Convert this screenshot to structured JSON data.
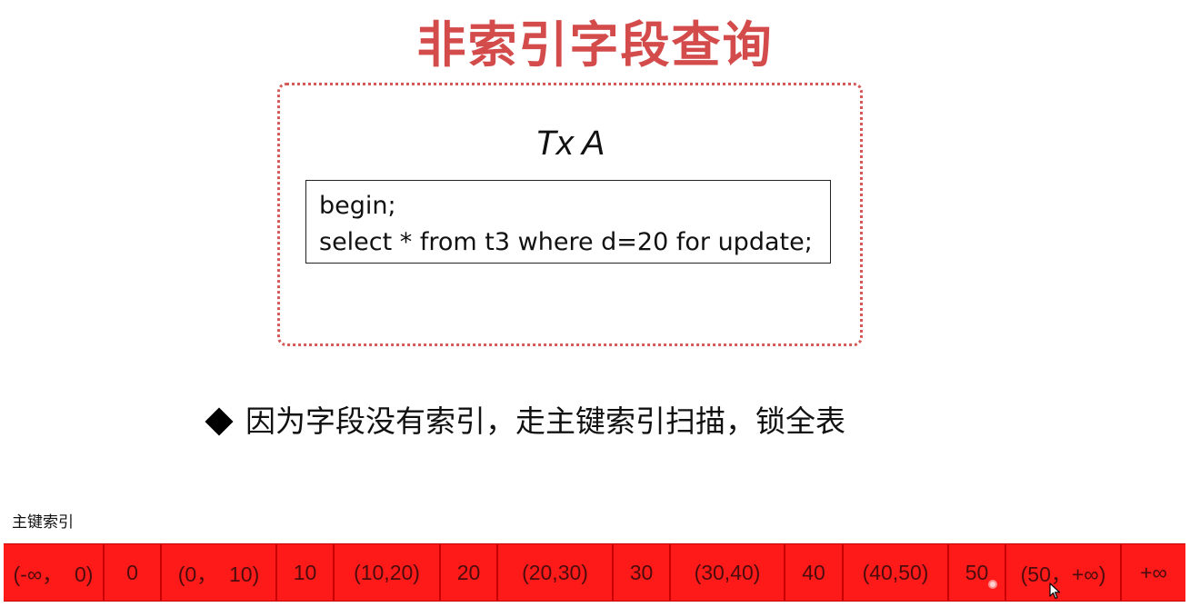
{
  "title": "非索引字段查询",
  "transaction": {
    "name": "Tx A",
    "sql": "begin;\nselect * from t3 where d=20 for update;"
  },
  "bullet": {
    "text": "因为字段没有索引，走主键索引扫描，锁全表",
    "icon": "diamond-bullet-icon"
  },
  "index": {
    "label": "主键索引",
    "color": "#ff1a1a",
    "cells": [
      "(-∞，  0)",
      "0",
      "(0，  10)",
      "10",
      "(10,20)",
      "20",
      "(20,30)",
      "30",
      "(30,40)",
      "40",
      "(40,50)",
      "50",
      "(50，+∞)",
      "+∞"
    ]
  },
  "colors": {
    "title": "#d44b4b",
    "box_border": "#d45a5a",
    "locked": "#ff1a1a"
  }
}
